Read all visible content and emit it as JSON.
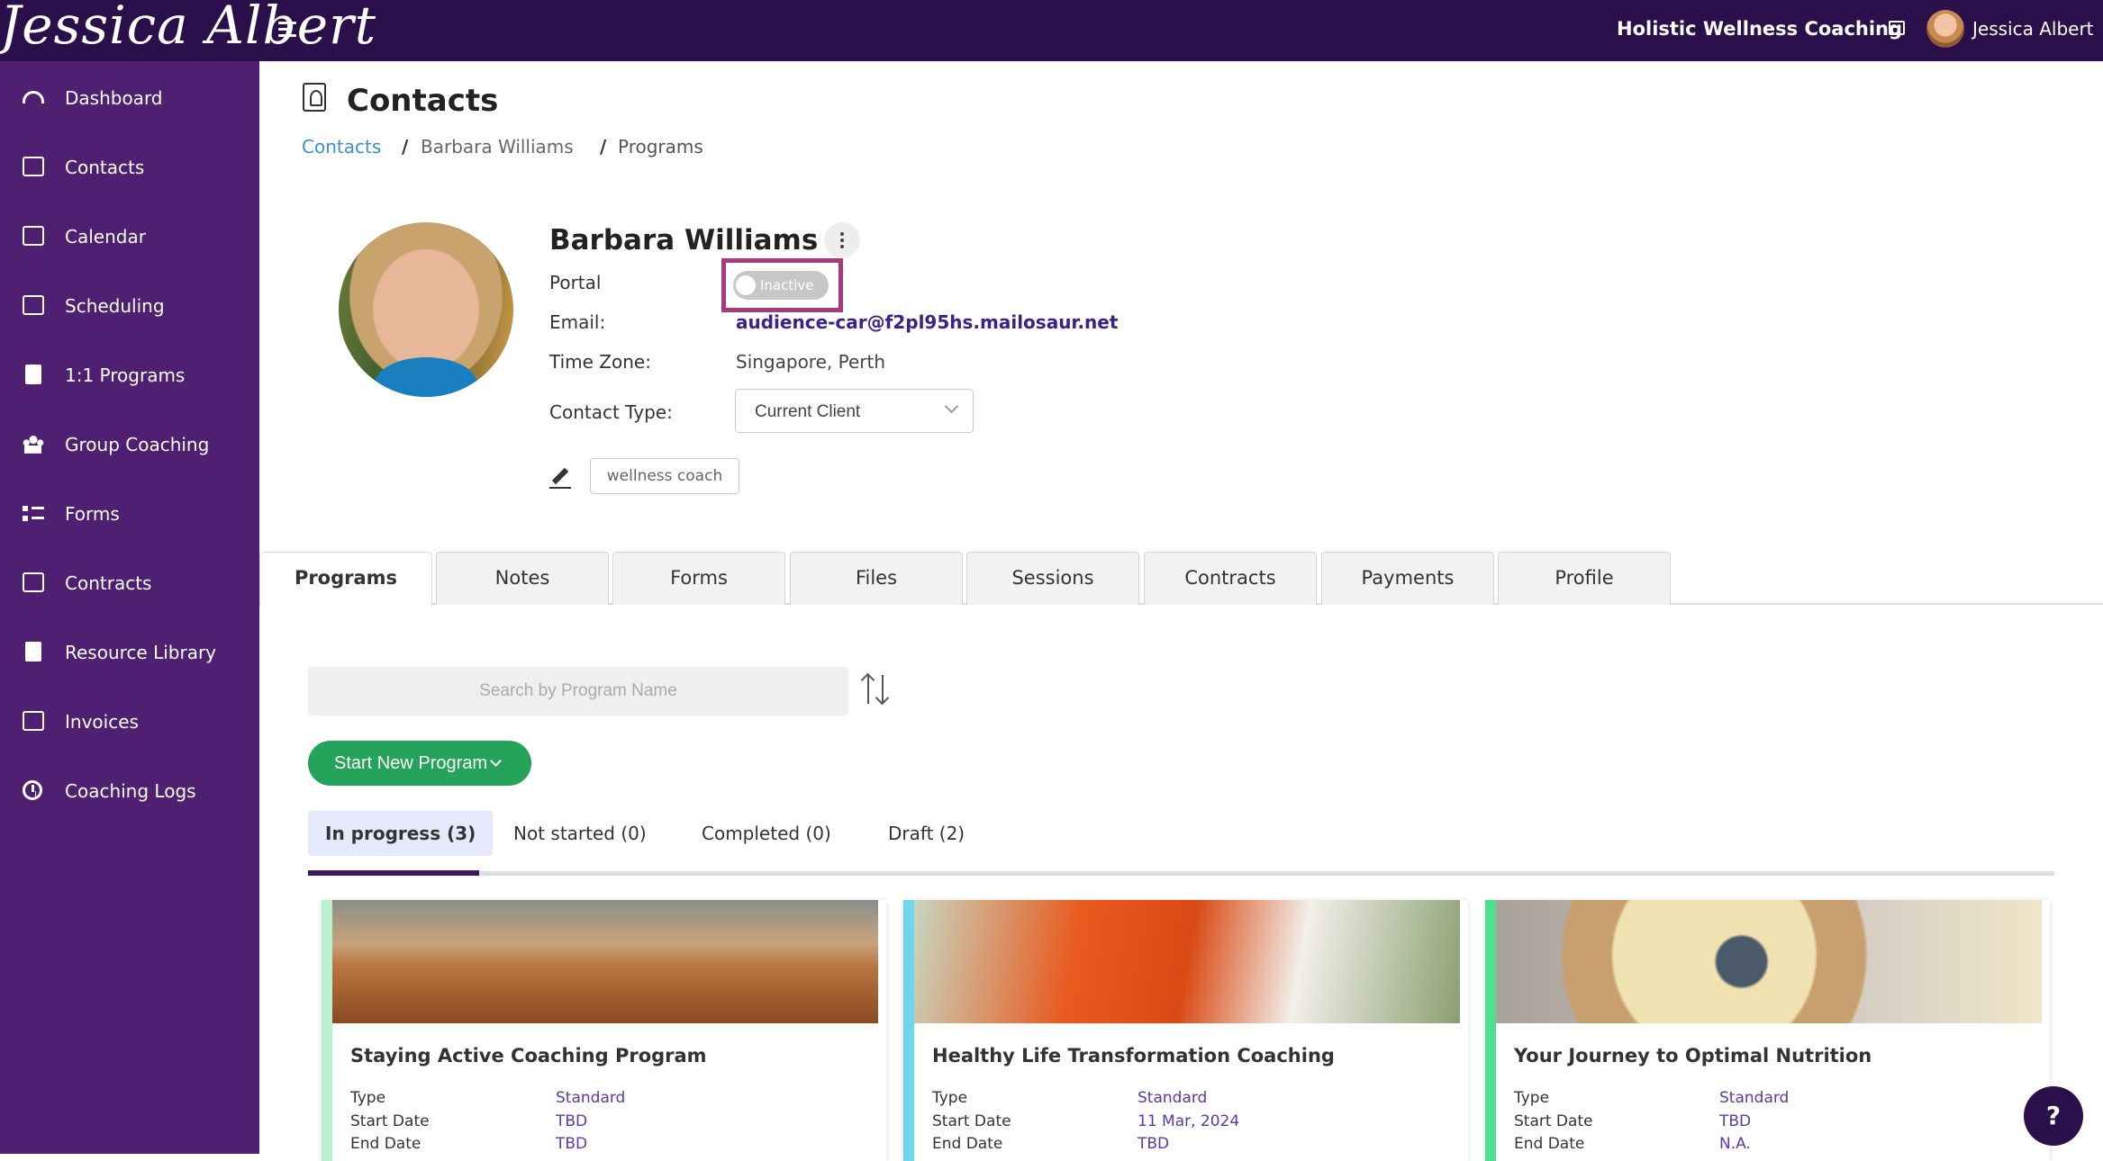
{
  "topbar": {
    "logo": "Jessica Albert",
    "business_name": "Holistic Wellness Coaching",
    "user_name": "Jessica Albert"
  },
  "sidebar": {
    "items": [
      {
        "label": "Dashboard",
        "icon": "dashboard-icon"
      },
      {
        "label": "Contacts",
        "icon": "contacts-icon"
      },
      {
        "label": "Calendar",
        "icon": "calendar-icon"
      },
      {
        "label": "Scheduling",
        "icon": "scheduling-icon"
      },
      {
        "label": "1:1 Programs",
        "icon": "book-icon"
      },
      {
        "label": "Group Coaching",
        "icon": "group-icon"
      },
      {
        "label": "Forms",
        "icon": "list-icon"
      },
      {
        "label": "Contracts",
        "icon": "signature-icon"
      },
      {
        "label": "Resource Library",
        "icon": "library-icon"
      },
      {
        "label": "Invoices",
        "icon": "invoice-icon"
      },
      {
        "label": "Coaching Logs",
        "icon": "clock-icon"
      }
    ]
  },
  "page": {
    "title": "Contacts",
    "breadcrumb": [
      "Contacts",
      "/",
      "Barbara Williams",
      "/",
      "Programs"
    ]
  },
  "contact": {
    "name": "Barbara Williams",
    "portal_label": "Portal",
    "portal_status": "Inactive",
    "email_label": "Email:",
    "email": "audience-car@f2pl95hs.mailosaur.net",
    "timezone_label": "Time Zone:",
    "timezone": "Singapore, Perth",
    "contact_type_label": "Contact Type:",
    "contact_type": "Current Client",
    "tag": "wellness coach"
  },
  "tabs": [
    "Programs",
    "Notes",
    "Forms",
    "Files",
    "Sessions",
    "Contracts",
    "Payments",
    "Profile"
  ],
  "programs": {
    "search_placeholder": "Search by Program Name",
    "start_button": "Start New Program",
    "status_tabs": [
      "In progress (3)",
      "Not started (0)",
      "Completed (0)",
      "Draft (2)"
    ],
    "row_labels": [
      "Type",
      "Start Date",
      "End Date"
    ],
    "cards": [
      {
        "title": "Staying Active Coaching Program",
        "type": "Standard",
        "start": "TBD",
        "end": "TBD",
        "accent": "#b9f0cf"
      },
      {
        "title": "Healthy Life Transformation Coaching",
        "type": "Standard",
        "start": "11 Mar, 2024",
        "end": "TBD",
        "accent": "#6fd6ee"
      },
      {
        "title": "Your Journey to Optimal Nutrition",
        "type": "Standard",
        "start": "TBD",
        "end": "N.A.",
        "accent": "#4fe08f"
      }
    ]
  },
  "help_label": "?",
  "colors": {
    "topbar": "#2a0f4a",
    "sidebar": "#4f1f72",
    "link": "#3a8fd6",
    "accent_green": "#25a35a",
    "highlight": "#a8397c"
  }
}
